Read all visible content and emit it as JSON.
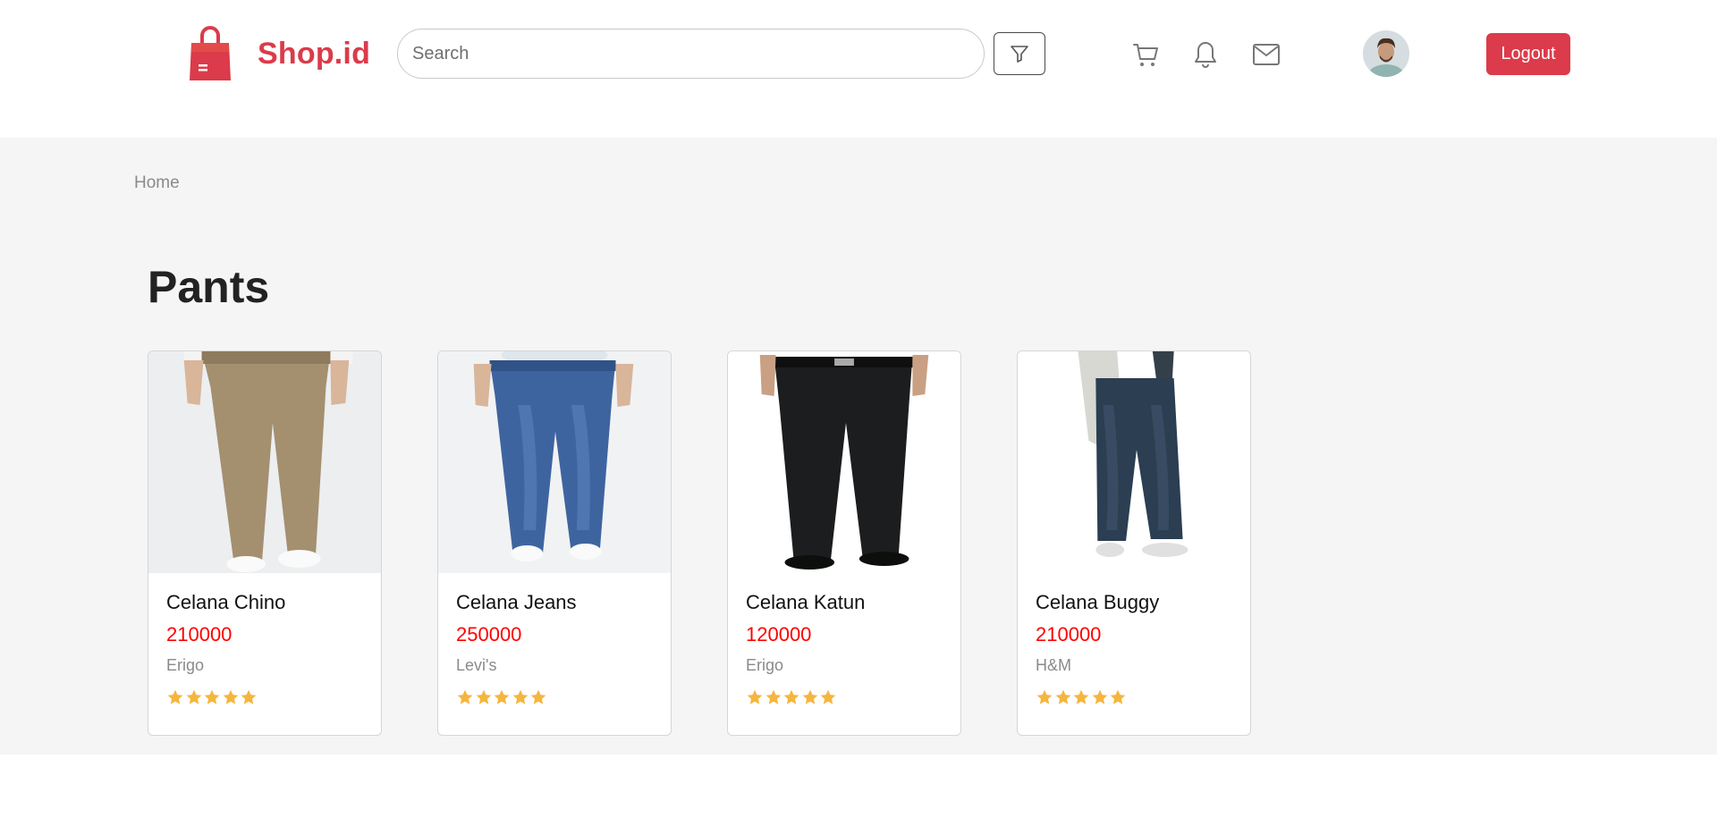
{
  "brand": {
    "name": "Shop.id",
    "color": "#db3b4a"
  },
  "header": {
    "search_placeholder": "Search",
    "icons": [
      "funnel-icon",
      "cart-icon",
      "bell-icon",
      "envelope-icon"
    ],
    "logout_label": "Logout"
  },
  "breadcrumb": {
    "home": "Home"
  },
  "page": {
    "title": "Pants"
  },
  "colors": {
    "price": "#ff0000",
    "star": "#f6b53d",
    "background": "#f5f5f5"
  },
  "products": [
    {
      "name": "Celana Chino",
      "price": "210000",
      "brand": "Erigo",
      "rating": 5
    },
    {
      "name": "Celana Jeans",
      "price": "250000",
      "brand": "Levi's",
      "rating": 5
    },
    {
      "name": "Celana Katun",
      "price": "120000",
      "brand": "Erigo",
      "rating": 5
    },
    {
      "name": "Celana Buggy",
      "price": "210000",
      "brand": "H&M",
      "rating": 5
    }
  ]
}
